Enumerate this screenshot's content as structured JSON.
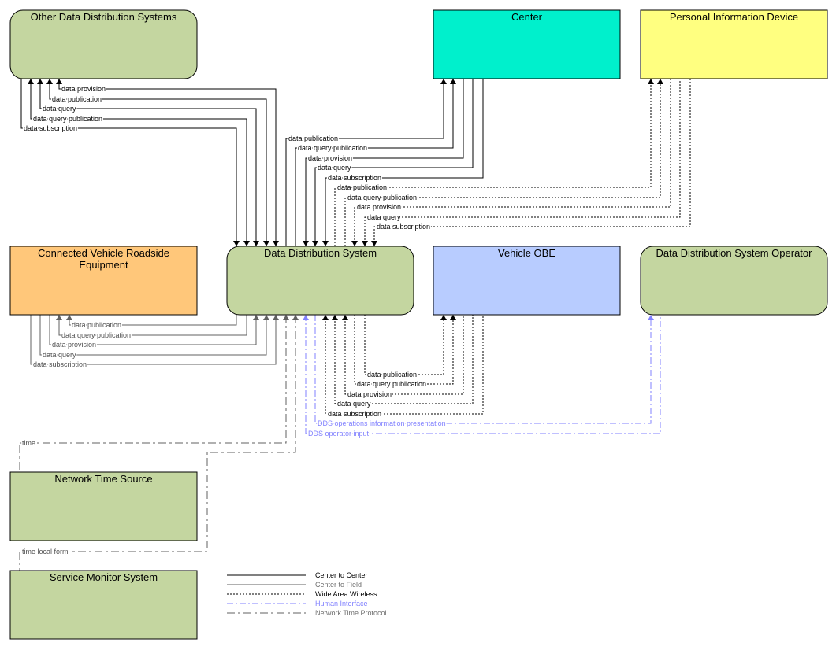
{
  "boxes": [
    {
      "id": "other-dds",
      "title": [
        "Other Data Distribution Systems"
      ],
      "color": "#c4d6a0",
      "rounded": true
    },
    {
      "id": "center",
      "title": [
        "Center"
      ],
      "color": "#00f0cc",
      "rounded": false
    },
    {
      "id": "pid",
      "title": [
        "Personal Information Device"
      ],
      "color": "#ffff80",
      "rounded": false
    },
    {
      "id": "cvre",
      "title": [
        "Connected Vehicle Roadside",
        "Equipment"
      ],
      "color": "#ffc77a",
      "rounded": false
    },
    {
      "id": "dds",
      "title": [
        "Data Distribution System"
      ],
      "color": "#c4d6a0",
      "rounded": true
    },
    {
      "id": "vehicle-obe",
      "title": [
        "Vehicle OBE"
      ],
      "color": "#b8ccff",
      "rounded": false
    },
    {
      "id": "dds-operator",
      "title": [
        "Data Distribution System Operator"
      ],
      "color": "#c4d6a0",
      "rounded": true
    },
    {
      "id": "network-time-source",
      "title": [
        "Network Time Source"
      ],
      "color": "#c4d6a0",
      "rounded": false
    },
    {
      "id": "service-monitor",
      "title": [
        "Service Monitor System"
      ],
      "color": "#c4d6a0",
      "rounded": false
    }
  ],
  "flows": [
    {
      "label": "data provision",
      "type": "center-to-center"
    },
    {
      "label": "data publication",
      "type": "center-to-center"
    },
    {
      "label": "data query",
      "type": "center-to-center"
    },
    {
      "label": "data query publication",
      "type": "center-to-center"
    },
    {
      "label": "data subscription",
      "type": "center-to-center"
    },
    {
      "label": "data publication",
      "type": "center-to-center"
    },
    {
      "label": "data query publication",
      "type": "center-to-center"
    },
    {
      "label": "data provision",
      "type": "center-to-center"
    },
    {
      "label": "data query",
      "type": "center-to-center"
    },
    {
      "label": "data subscription",
      "type": "center-to-center"
    },
    {
      "label": "data publication",
      "type": "wide-area-wireless"
    },
    {
      "label": "data query publication",
      "type": "wide-area-wireless"
    },
    {
      "label": "data provision",
      "type": "wide-area-wireless"
    },
    {
      "label": "data query",
      "type": "wide-area-wireless"
    },
    {
      "label": "data subscription",
      "type": "wide-area-wireless"
    },
    {
      "label": "data publication",
      "type": "center-to-field"
    },
    {
      "label": "data query publication",
      "type": "center-to-field"
    },
    {
      "label": "data provision",
      "type": "center-to-field"
    },
    {
      "label": "data query",
      "type": "center-to-field"
    },
    {
      "label": "data subscription",
      "type": "center-to-field"
    },
    {
      "label": "data publication",
      "type": "wide-area-wireless"
    },
    {
      "label": "data query publication",
      "type": "wide-area-wireless"
    },
    {
      "label": "data provision",
      "type": "wide-area-wireless"
    },
    {
      "label": "data query",
      "type": "wide-area-wireless"
    },
    {
      "label": "data subscription",
      "type": "wide-area-wireless"
    },
    {
      "label": "DDS operations information presentation",
      "type": "human-interface"
    },
    {
      "label": "DDS operator input",
      "type": "human-interface"
    },
    {
      "label": "time",
      "type": "network-time-protocol"
    },
    {
      "label": "time local form",
      "type": "network-time-protocol"
    }
  ],
  "legend": [
    {
      "type": "center-to-center",
      "label": "Center to Center",
      "color": "#000000",
      "text_color": "#000000"
    },
    {
      "type": "center-to-field",
      "label": "Center to Field",
      "color": "#606060",
      "text_color": "#707070"
    },
    {
      "type": "wide-area-wireless",
      "label": "Wide Area Wireless",
      "color": "#000000",
      "text_color": "#000000"
    },
    {
      "type": "human-interface",
      "label": "Human Interface",
      "color": "#8080ff",
      "text_color": "#8080ff"
    },
    {
      "type": "network-time-protocol",
      "label": "Network Time Protocol",
      "color": "#606060",
      "text_color": "#707070"
    }
  ]
}
